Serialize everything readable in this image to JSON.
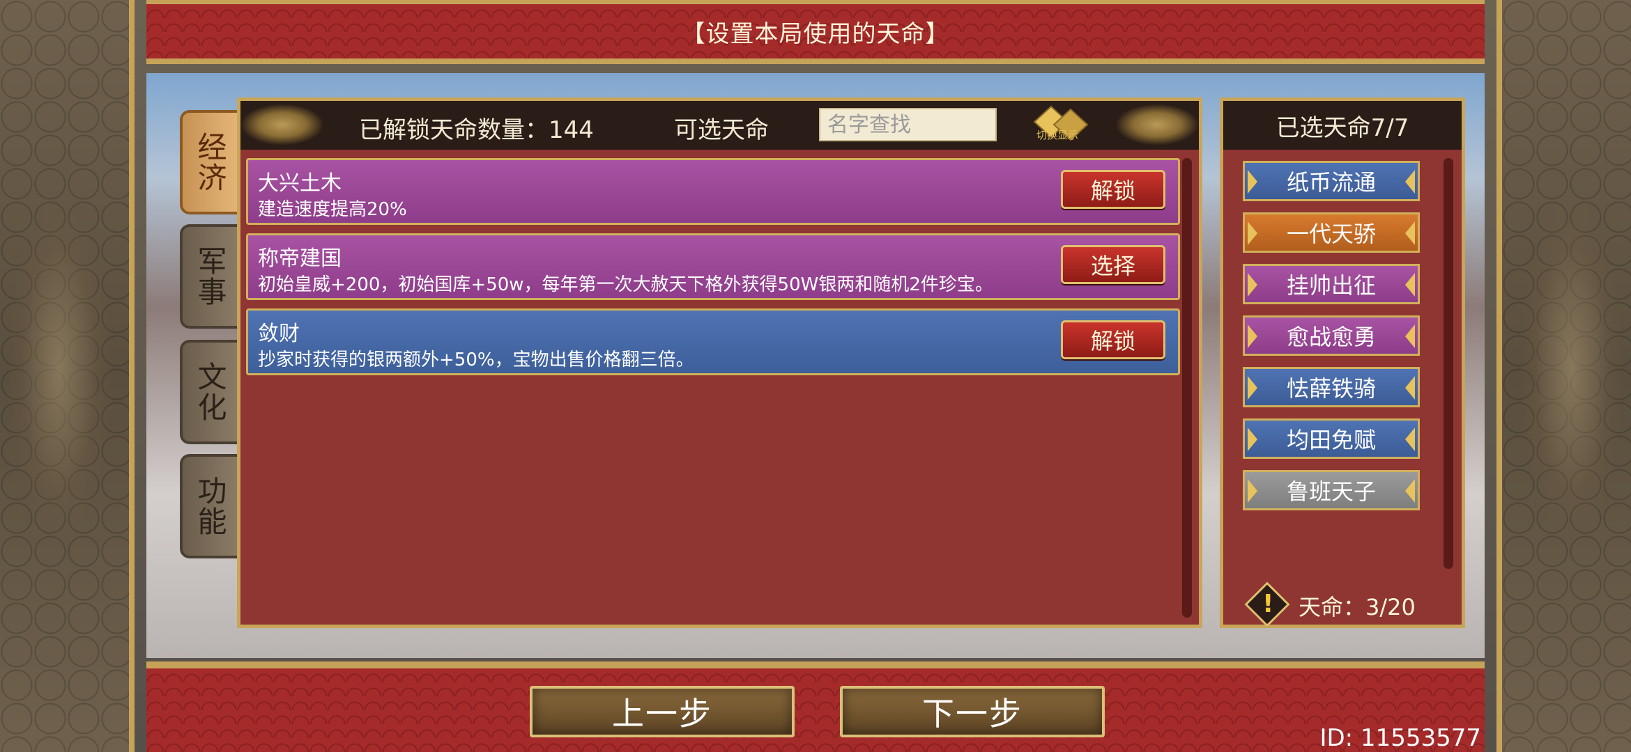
{
  "title": "【设置本局使用的天命】",
  "tabs": [
    {
      "label": "经济",
      "active": true
    },
    {
      "label": "军事",
      "active": false
    },
    {
      "label": "文化",
      "active": false
    },
    {
      "label": "功能",
      "active": false
    }
  ],
  "main": {
    "unlock_count": "已解锁天命数量：144",
    "selectable_label": "可选天命",
    "search_placeholder": "名字查找",
    "toggle_label": "切换显示",
    "items": [
      {
        "name": "大兴土木",
        "desc": "建造速度提高20%",
        "button": "解锁",
        "color": "#a853a3"
      },
      {
        "name": "称帝建国",
        "desc": "初始皇威+200，初始国库+50w，每年第一次大赦天下格外获得50W银两和随机2件珍宝。",
        "button": "选择",
        "color": "#a853a3"
      },
      {
        "name": "敛财",
        "desc": "抄家时获得的银两额外+50%，宝物出售价格翻三倍。",
        "button": "解锁",
        "color": "#4f73b3"
      }
    ]
  },
  "right": {
    "header": "已选天命7/7",
    "chosen": [
      {
        "label": "纸币流通",
        "color": "blue"
      },
      {
        "label": "一代天骄",
        "color": "orange"
      },
      {
        "label": "挂帅出征",
        "color": "purple"
      },
      {
        "label": "愈战愈勇",
        "color": "purple"
      },
      {
        "label": "怯薛铁骑",
        "color": "blue"
      },
      {
        "label": "均田免赋",
        "color": "blue"
      },
      {
        "label": "鲁班天子",
        "color": "gray"
      }
    ],
    "fate_count": "天命：3/20",
    "warn_mark": "!"
  },
  "buttons": {
    "prev": "上一步",
    "next": "下一步"
  },
  "id": "ID: 11553577"
}
